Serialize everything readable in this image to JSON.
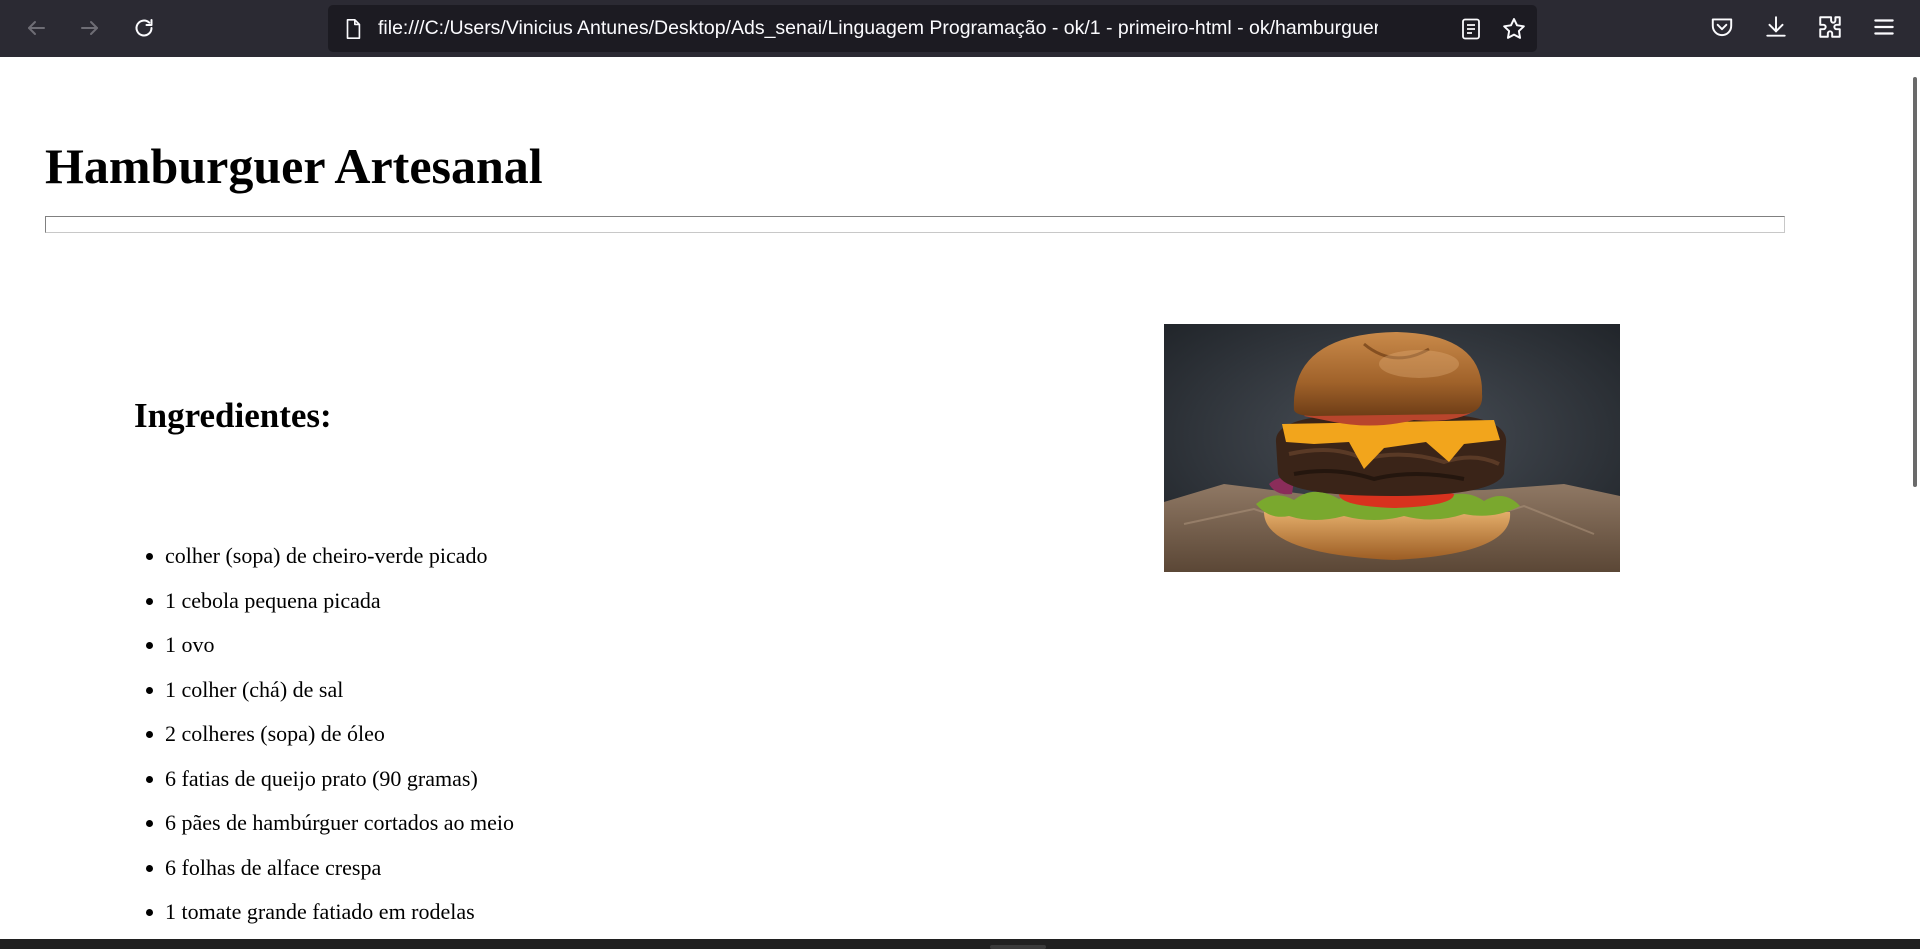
{
  "browser": {
    "url": "file:///C:/Users/Vinicius Antunes/Desktop/Ads_senai/Linguagem Programação - ok/1 - primeiro-html - ok/hamburguer",
    "icons": [
      "back-arrow-icon",
      "forward-arrow-icon",
      "reload-icon",
      "page-icon",
      "reader-view-icon",
      "bookmark-star-icon",
      "pocket-icon",
      "download-icon",
      "extensions-icon",
      "menu-icon"
    ]
  },
  "page": {
    "title": "Hamburguer Artesanal",
    "ingredients_heading": "Ingredientes:",
    "ingredients": [
      "colher (sopa) de cheiro-verde picado",
      "1 cebola pequena picada",
      "1 ovo",
      "1 colher (chá) de sal",
      "2 colheres (sopa) de óleo",
      "6 fatias de queijo prato (90 gramas)",
      "6 pães de hambúrguer cortados ao meio",
      "6 folhas de alface crespa",
      "1 tomate grande fatiado em rodelas"
    ]
  },
  "colors": {
    "toolbar": "#2b2a33",
    "urlbar": "#1c1b22",
    "text": "#000000",
    "background": "#ffffff"
  }
}
